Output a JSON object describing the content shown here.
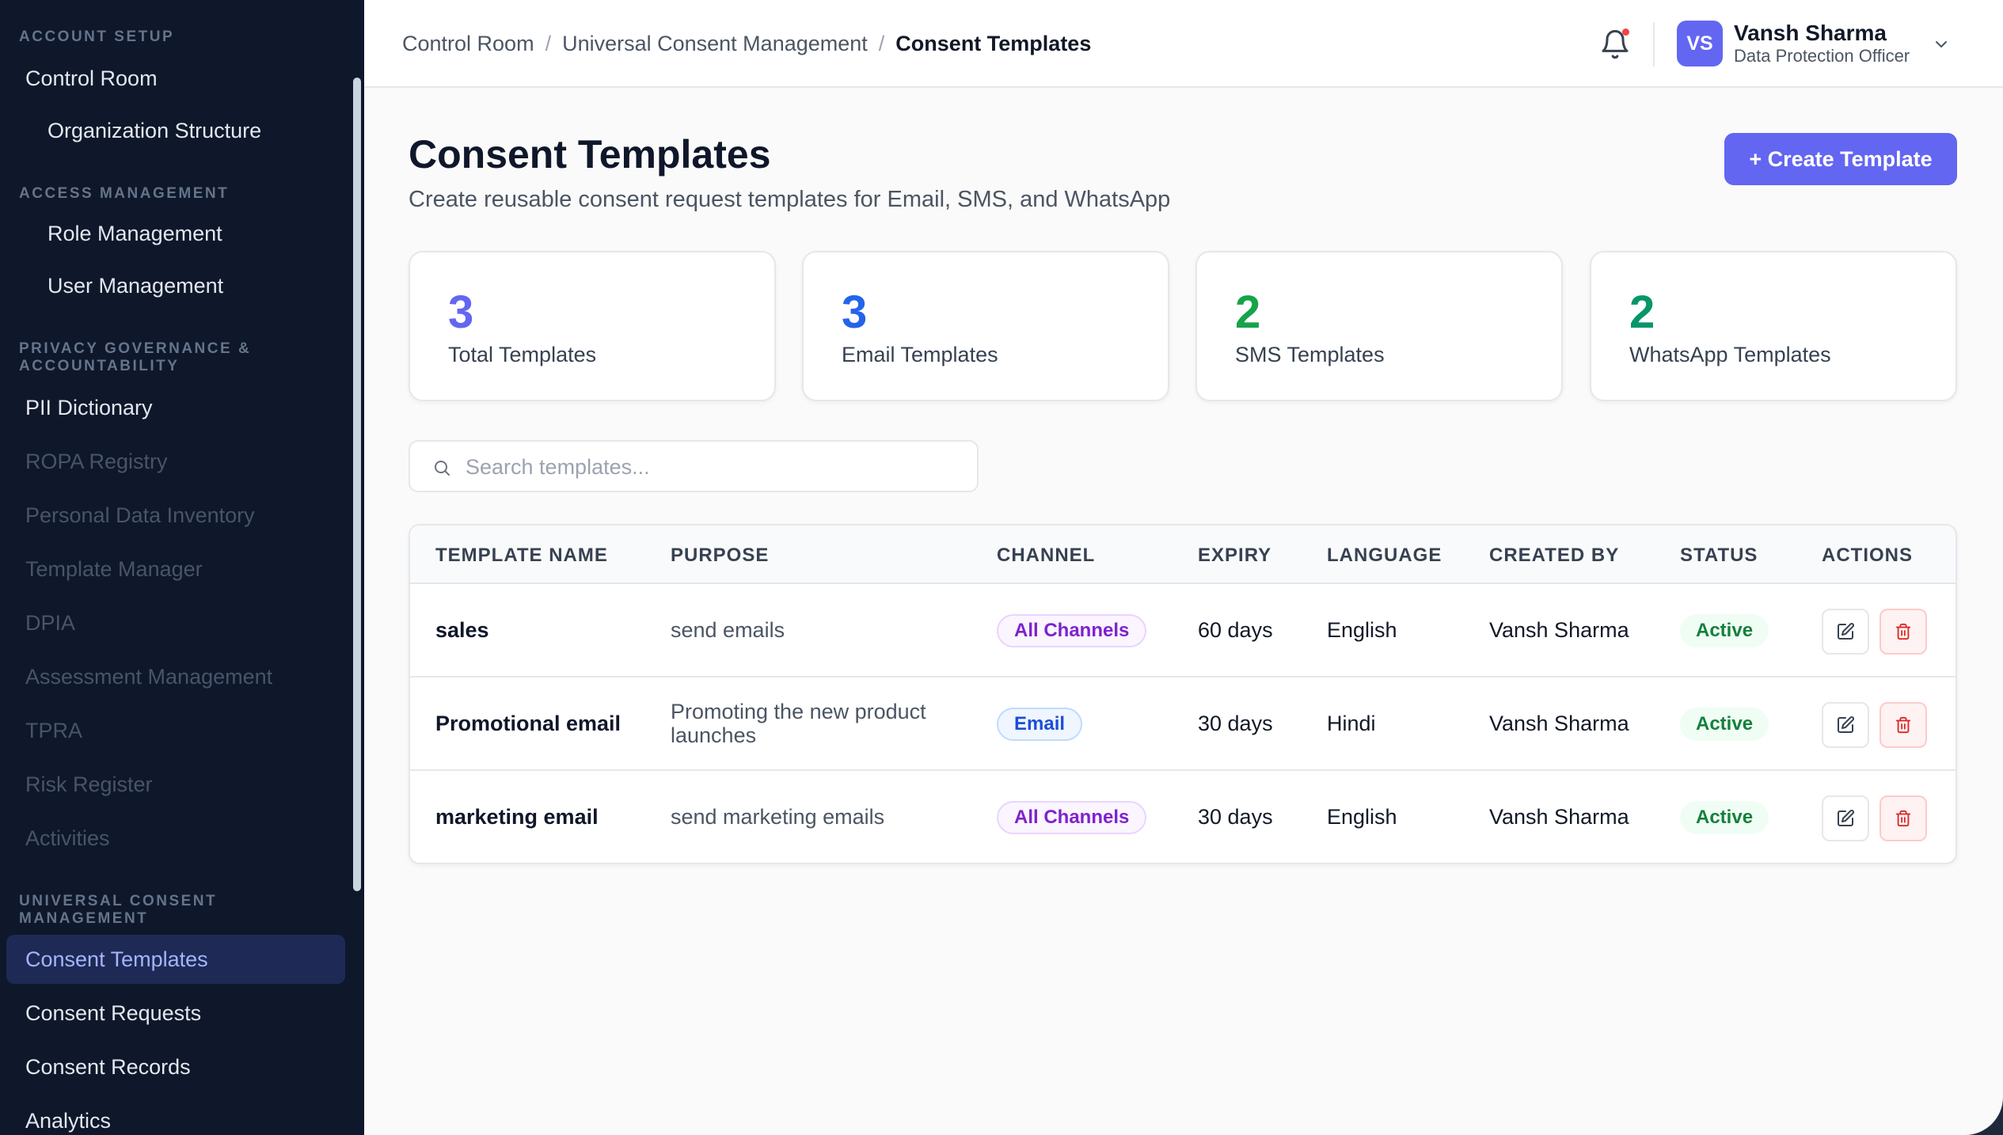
{
  "sidebar": {
    "sections": [
      {
        "title": "ACCOUNT SETUP"
      },
      {
        "title": "ACCESS MANAGEMENT"
      },
      {
        "title": "PRIVACY GOVERNANCE & ACCOUNTABILITY"
      },
      {
        "title": "UNIVERSAL CONSENT MANAGEMENT"
      }
    ],
    "items": {
      "control_room": "Control Room",
      "organization_structure": "Organization Structure",
      "role_management": "Role Management",
      "user_management": "User Management",
      "pii_dictionary": "PII Dictionary",
      "ropa_registry": "ROPA Registry",
      "personal_data_inventory": "Personal Data Inventory",
      "template_manager": "Template Manager",
      "dpia": "DPIA",
      "assessment_management": "Assessment Management",
      "tpra": "TPRA",
      "risk_register": "Risk Register",
      "activities": "Activities",
      "consent_templates": "Consent Templates",
      "consent_requests": "Consent Requests",
      "consent_records": "Consent Records",
      "analytics": "Analytics"
    }
  },
  "header": {
    "breadcrumbs": [
      "Control Room",
      "Universal Consent Management",
      "Consent Templates"
    ],
    "separator": "/",
    "user": {
      "initials": "VS",
      "name": "Vansh Sharma",
      "role": "Data Protection Officer"
    }
  },
  "page": {
    "title": "Consent Templates",
    "subtitle": "Create reusable consent request templates for Email, SMS, and WhatsApp",
    "create_button": "+ Create Template"
  },
  "stats": [
    {
      "value": "3",
      "label": "Total Templates",
      "color": "#6366f1"
    },
    {
      "value": "3",
      "label": "Email Templates",
      "color": "#2563eb"
    },
    {
      "value": "2",
      "label": "SMS Templates",
      "color": "#16a34a"
    },
    {
      "value": "2",
      "label": "WhatsApp Templates",
      "color": "#059669"
    }
  ],
  "search": {
    "placeholder": "Search templates..."
  },
  "table": {
    "columns": [
      "TEMPLATE NAME",
      "PURPOSE",
      "CHANNEL",
      "EXPIRY",
      "LANGUAGE",
      "CREATED BY",
      "STATUS",
      "ACTIONS"
    ],
    "rows": [
      {
        "name": "sales",
        "purpose": "send emails",
        "channel": "All Channels",
        "expiry": "60 days",
        "language": "English",
        "created_by": "Vansh Sharma",
        "status": "Active"
      },
      {
        "name": "Promotional email",
        "purpose": "Promoting the new product launches",
        "channel": "Email",
        "expiry": "30 days",
        "language": "Hindi",
        "created_by": "Vansh Sharma",
        "status": "Active"
      },
      {
        "name": "marketing email",
        "purpose": "send marketing emails",
        "channel": "All Channels",
        "expiry": "30 days",
        "language": "English",
        "created_by": "Vansh Sharma",
        "status": "Active"
      }
    ]
  },
  "colors": {
    "accent": "#6366f1",
    "sidebar_bg": "#0f172a",
    "active_status": "#15803d",
    "danger": "#dc2626"
  }
}
